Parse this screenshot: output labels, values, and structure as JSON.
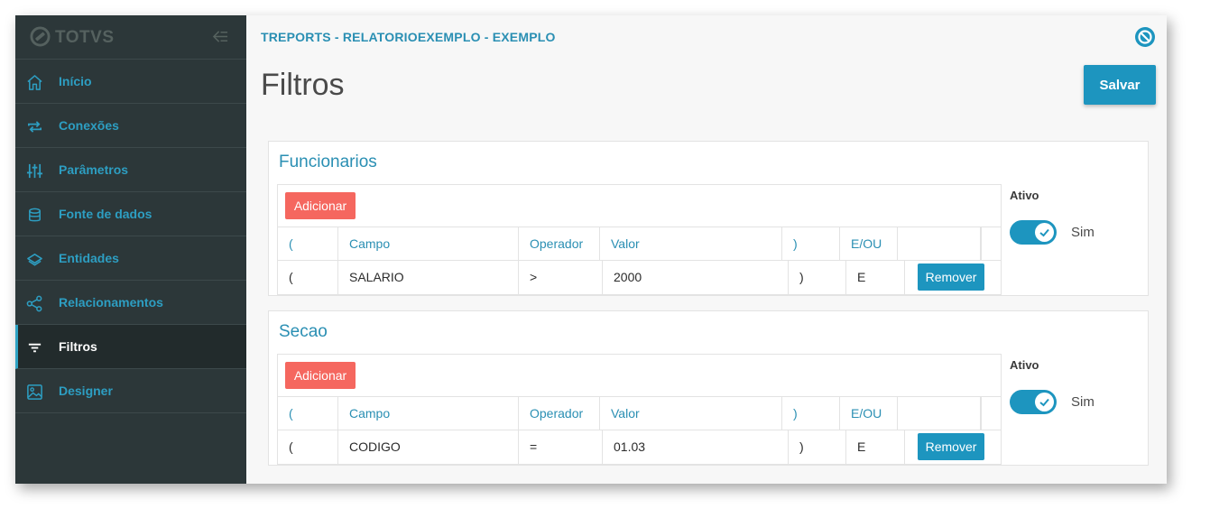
{
  "app": {
    "brand": "TOTVS"
  },
  "sidebar": {
    "items": [
      {
        "label": "Início",
        "icon": "home-icon",
        "active": false
      },
      {
        "label": "Conexões",
        "icon": "sync-icon",
        "active": false
      },
      {
        "label": "Parâmetros",
        "icon": "sliders-icon",
        "active": false
      },
      {
        "label": "Fonte de dados",
        "icon": "database-icon",
        "active": false
      },
      {
        "label": "Entidades",
        "icon": "layers-icon",
        "active": false
      },
      {
        "label": "Relacionamentos",
        "icon": "share-icon",
        "active": false
      },
      {
        "label": "Filtros",
        "icon": "filter-icon",
        "active": true
      },
      {
        "label": "Designer",
        "icon": "image-icon",
        "active": false
      }
    ]
  },
  "header": {
    "breadcrumb": "TREPORTS - RELATORIOEXEMPLO - EXEMPLO",
    "title": "Filtros",
    "save_label": "Salvar"
  },
  "columns": [
    "(",
    "Campo",
    "Operador",
    "Valor",
    ")",
    "E/OU",
    ""
  ],
  "filters": [
    {
      "title": "Funcionarios",
      "add_label": "Adicionar",
      "row": {
        "open": "(",
        "campo": "SALARIO",
        "operador": ">",
        "valor": "2000",
        "close": ")",
        "eou": "E",
        "remove_label": "Remover"
      },
      "ativo_label": "Ativo",
      "ativo_text": "Sim",
      "ativo": true
    },
    {
      "title": "Secao",
      "add_label": "Adicionar",
      "row": {
        "open": "(",
        "campo": "CODIGO",
        "operador": "=",
        "valor": "01.03",
        "close": ")",
        "eou": "E",
        "remove_label": "Remover"
      },
      "ativo_label": "Ativo",
      "ativo_text": "Sim",
      "ativo": true
    }
  ],
  "colors": {
    "sidebar_bg": "#2c3739",
    "accent": "#1d95bf",
    "link": "#2d9ec2",
    "add_button": "#f5675f"
  }
}
